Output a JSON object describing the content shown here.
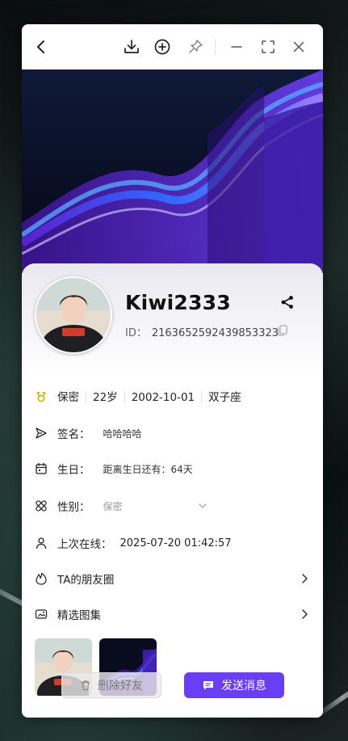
{
  "window": {
    "titlebar": {
      "back_icon": "chevron-left-icon",
      "download_icon": "download-icon",
      "add_icon": "plus-circle-icon",
      "pin_icon": "pin-icon",
      "minimize_icon": "minimize-icon",
      "maximize_icon": "maximize-icon",
      "close_icon": "close-icon"
    }
  },
  "banner": {
    "theme_icon": "palette-icon",
    "theme_color": "#2f8a5e"
  },
  "profile": {
    "username": "Kiwi2333",
    "id_label": "ID：",
    "id_value": "2163652592439853323",
    "share_icon": "share-icon",
    "copy_icon": "copy-icon"
  },
  "info": {
    "tags": [
      "保密",
      "22岁",
      "2002-10-01",
      "双子座"
    ],
    "signature_label": "签名：",
    "signature_value": "哈哈哈哈",
    "birthday_label": "生日：",
    "birthday_value": "距离生日还有：64天",
    "gender_label": "性别：",
    "gender_value": "保密",
    "last_online_label": "上次在线：",
    "last_online_value": "2025-07-20 01:42:57",
    "moments_label": "TA的朋友圈",
    "gallery_label": "精选图集"
  },
  "actions": {
    "delete_label": "删除好友",
    "send_label": "发送消息",
    "accent": "#6a3ef5"
  }
}
